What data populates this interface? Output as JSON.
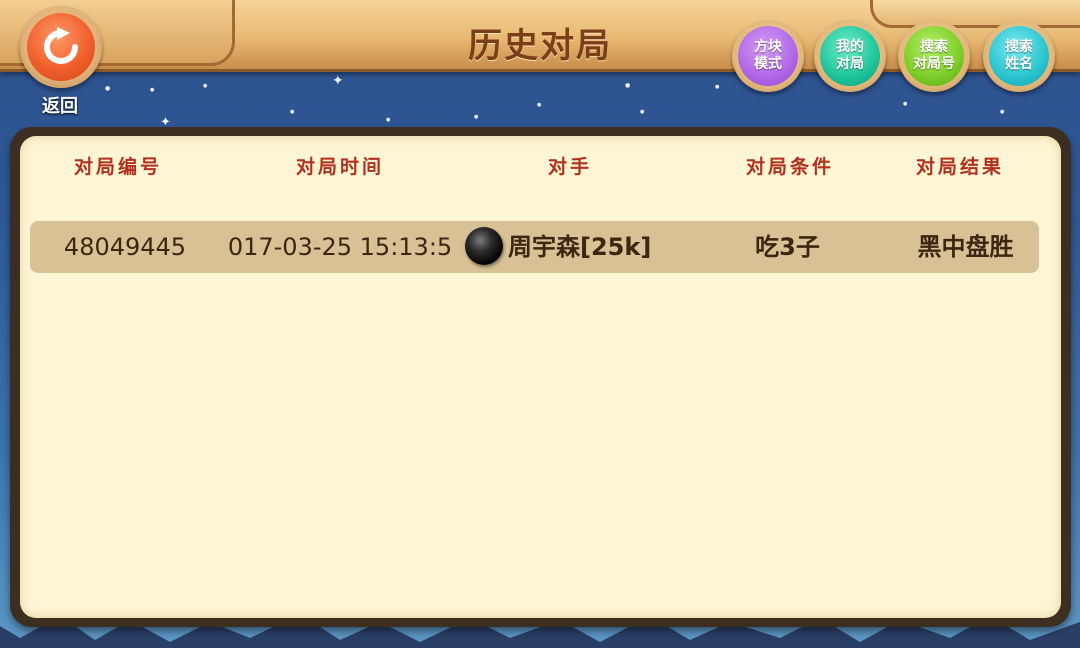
{
  "header": {
    "title": "历史对局",
    "back_label": "返回"
  },
  "actions": [
    {
      "label": "方块\n模式",
      "color": "#b066e6"
    },
    {
      "label": "我的\n对局",
      "color": "#1fc39a"
    },
    {
      "label": "搜索\n对局号",
      "color": "#7ccd27"
    },
    {
      "label": "搜索\n姓名",
      "color": "#29c4cf"
    }
  ],
  "table": {
    "columns": [
      "对局编号",
      "对局时间",
      "对手",
      "对局条件",
      "对局结果"
    ],
    "rows": [
      {
        "game_id": "48049445",
        "time": "017-03-25 15:13:5",
        "opponent_stone": "black-stone",
        "opponent": "周宇森[25k]",
        "condition": "吃3子",
        "result": "黑中盘胜"
      }
    ]
  },
  "icons": {
    "back": "refresh-arrow-icon",
    "stone": "black-stone-icon"
  },
  "colors": {
    "header_text": "#b2301e",
    "panel_bg": "#fdf5d3",
    "row_bg": "#d8c295",
    "back_button": "#f0602c"
  }
}
